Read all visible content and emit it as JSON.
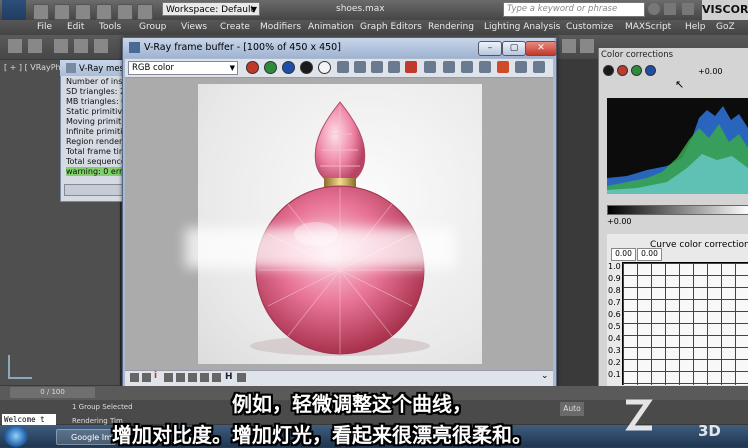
{
  "app": {
    "workspace": "Workspace: Default",
    "title": "shoes.max",
    "search_placeholder": "Type a keyword or phrase",
    "brand": "VISCOR"
  },
  "menu": [
    "File",
    "Edit",
    "Tools",
    "Group",
    "Views",
    "Create",
    "Modifiers",
    "Animation",
    "Graph Editors",
    "Rendering",
    "Lighting Analysis",
    "Customize",
    "MAXScript",
    "Help",
    "GoZ"
  ],
  "viewport": {
    "label": "[ + ] [ VRayPhy"
  },
  "messages": {
    "title": "V-Ray mes",
    "lines": [
      "Number of inst",
      "SD triangles: 2",
      "MB triangles: 0",
      "Static primitive",
      "Moving primitiv",
      "Infinite primitiv",
      "Region renderin",
      "Total frame tim",
      "Total sequence"
    ],
    "warning": "warning: 0 error"
  },
  "framebuffer": {
    "title": "V-Ray frame buffer - [100% of 450 x 450]",
    "channel": "RGB color",
    "colors": {
      "red": "#c0392b",
      "green": "#2e8b3e",
      "blue": "#1f4ea8"
    }
  },
  "color_corrections": {
    "title": "Color corrections",
    "top_value": "+0.00",
    "bottom_value": "+0.00",
    "curve_title": "Curve color correction",
    "input_a": "0.00",
    "input_b": "0.00",
    "y_ticks": [
      "1.0",
      "0.9",
      "0.8",
      "0.7",
      "0.6",
      "0.5",
      "0.4",
      "0.3",
      "0.2",
      "0.1"
    ]
  },
  "timeline": {
    "frame": "0 / 100"
  },
  "status": {
    "welcome": "Welcome t",
    "selection": "1 Group Selected",
    "render_time": "Rendering Tim",
    "auto": "Auto"
  },
  "taskbar": {
    "item": "Google Im"
  },
  "subtitles": {
    "line1": "例如，轻微调整这个曲线，",
    "line2": "增加对比度。增加灯光，看起来很漂亮很柔和。"
  },
  "watermark": "3D"
}
